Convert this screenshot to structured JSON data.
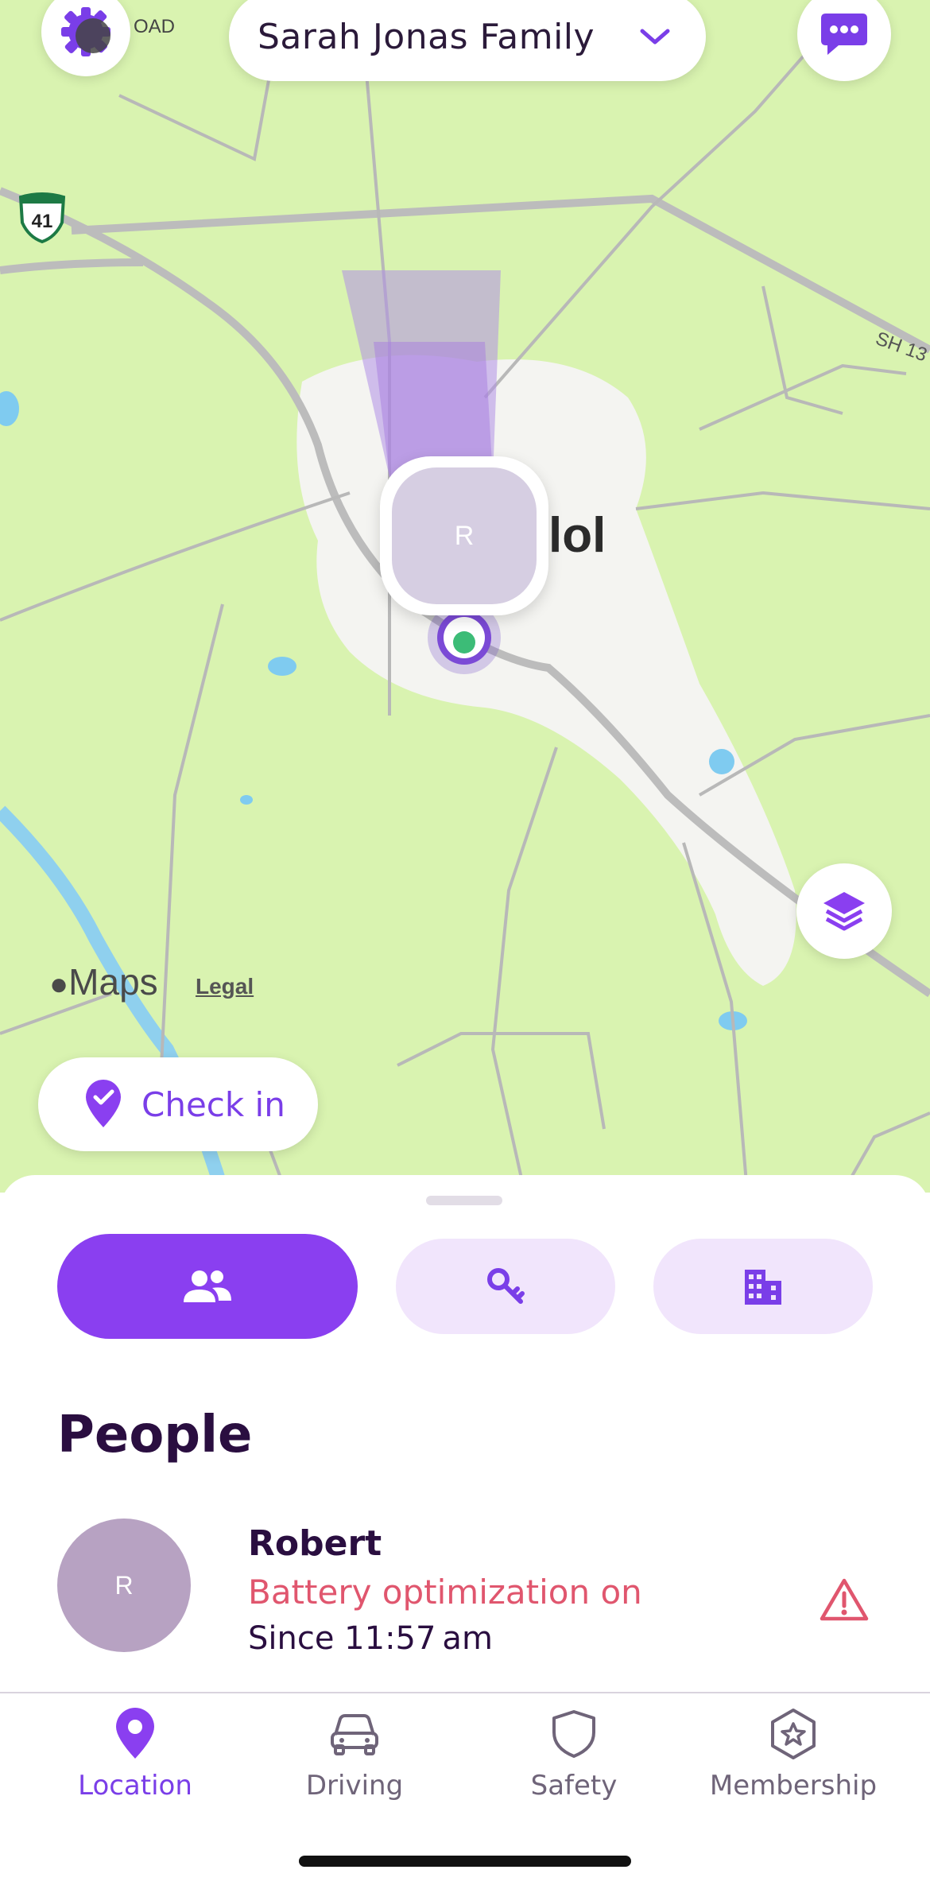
{
  "header": {
    "family_name": "Sarah Jonas Family",
    "road_fragment": "OAD",
    "settings_icon": "gear-icon",
    "chat_icon": "chat-bubble-icon",
    "chevron_icon": "chevron-down-icon"
  },
  "map": {
    "city_label": "lol",
    "highway_shield": "41",
    "highway_label": "SH 13",
    "maps_brand": "Maps",
    "legal_label": "Legal",
    "member_pin_initial": "R",
    "layers_icon": "layers-icon"
  },
  "checkin": {
    "label": "Check in"
  },
  "segments": [
    {
      "icon": "people-icon",
      "active": true
    },
    {
      "icon": "keys-icon",
      "active": false
    },
    {
      "icon": "buildings-icon",
      "active": false
    }
  ],
  "people": {
    "title": "People",
    "members": [
      {
        "initial": "R",
        "name": "Robert",
        "status": "Battery optimization on",
        "since": "Since 11:57 am"
      }
    ]
  },
  "tabs": [
    {
      "label": "Location",
      "icon": "location-pin-icon",
      "active": true
    },
    {
      "label": "Driving",
      "icon": "car-icon",
      "active": false
    },
    {
      "label": "Safety",
      "icon": "shield-icon",
      "active": false
    },
    {
      "label": "Membership",
      "icon": "star-badge-icon",
      "active": false
    }
  ],
  "colors": {
    "accent": "#8a3ff0",
    "warning": "#e0566e",
    "map_green": "#d9f3b0"
  }
}
